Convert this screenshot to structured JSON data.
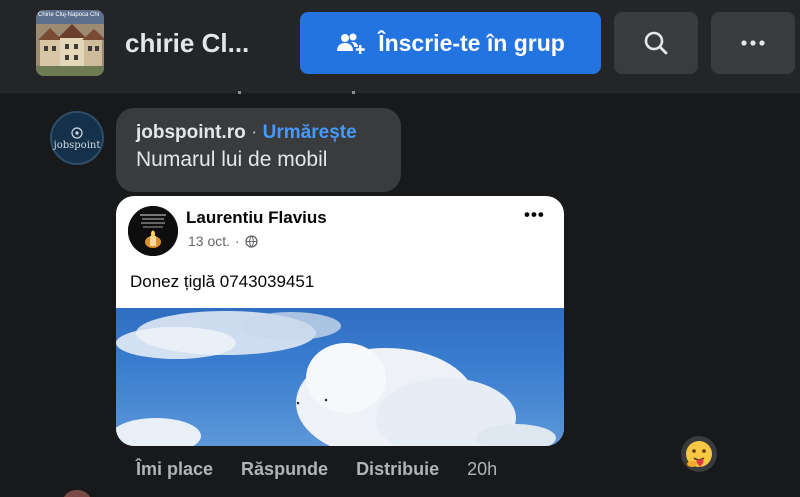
{
  "header": {
    "group_title": "chirie Cl...",
    "group_thumb_caption": "Chirie Cluj-Napoca Chi",
    "join_label": "Înscrie-te în grup",
    "search_icon": "search-icon",
    "more_icon": "more-horizontal-icon"
  },
  "comment": {
    "author": "jobspoint.ro",
    "separator": "·",
    "follow_label": "Urmărește",
    "text": "Numarul lui de mobil",
    "avatar_text": "jobspoint"
  },
  "shared_post": {
    "author": "Laurentiu Flavius",
    "date": "13 oct.",
    "audience_icon": "globe-icon",
    "more_label": "•••",
    "text": "Donez țiglă 0743039451"
  },
  "reaction_icon": "care-emoji-icon",
  "actions": {
    "like": "Îmi place",
    "reply": "Răspunde",
    "share": "Distribuie",
    "time": "20h"
  },
  "colors": {
    "background": "#18191a",
    "topbar": "#242526",
    "accent": "#2374e1",
    "follow_link": "#4599ff",
    "bubble": "#3a3b3c"
  }
}
